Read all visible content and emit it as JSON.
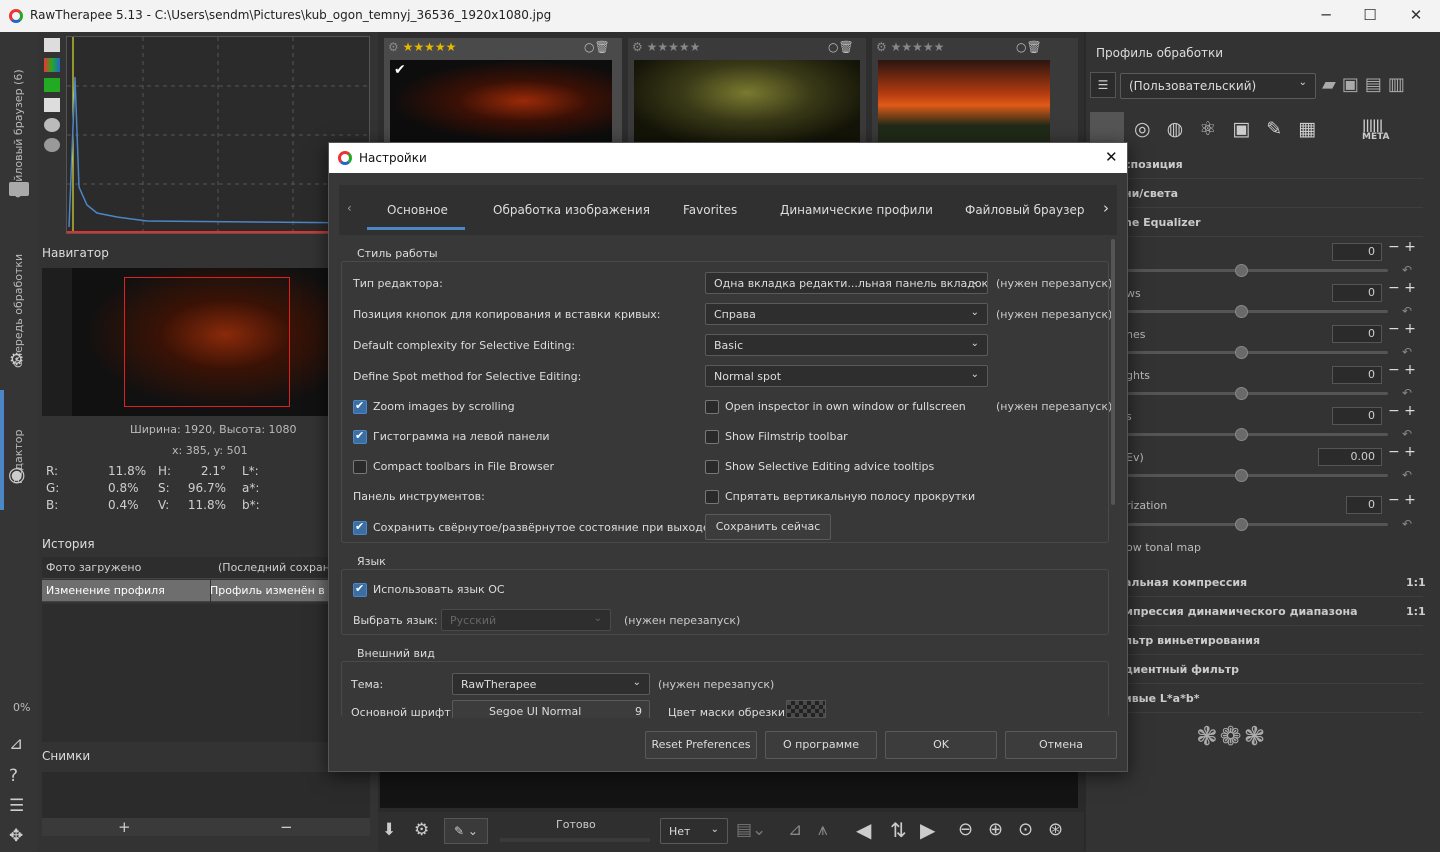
{
  "window": {
    "title": "RawTherapee 5.13 - C:\\Users\\sendm\\Pictures\\kub_ogon_temnyj_36536_1920x1080.jpg",
    "minimize": "─",
    "maximize": "☐",
    "close": "✕"
  },
  "sidebar": {
    "tabs": [
      "Файловый браузер (6)",
      "Очередь обработки",
      "Редактор"
    ],
    "zoom_label": "0%"
  },
  "navigator": {
    "title": "Навигатор",
    "dims": "Ширина: 1920, Высота: 1080",
    "coords": "x: 385, y: 501",
    "readout": [
      [
        "R:",
        "11.8%",
        "H:",
        "2.1°",
        "L*:"
      ],
      [
        "G:",
        "0.8%",
        "S:",
        "96.7%",
        "a*:"
      ],
      [
        "B:",
        "0.4%",
        "V:",
        "11.8%",
        "b*:"
      ]
    ]
  },
  "history": {
    "title": "История",
    "rows": [
      [
        "Фото загружено",
        "(Последний сохранё"
      ],
      [
        "Изменение профиля",
        "Профиль изменён в б"
      ]
    ]
  },
  "snapshots": {
    "title": "Снимки",
    "add": "+",
    "remove": "−"
  },
  "filmstrip": {
    "thumbs": [
      {
        "stars": "★★★★★",
        "filled": true
      },
      {
        "stars": "★★★★★",
        "filled": false
      },
      {
        "stars": "★★★★★",
        "filled": false
      }
    ]
  },
  "right": {
    "profile_title": "Профиль обработки",
    "profile_value": "(Пользовательский)",
    "meta": "META",
    "sections": [
      "спозиция",
      "ни/света",
      "ne Equalizer"
    ],
    "sliders": [
      {
        "label": "",
        "value": "0"
      },
      {
        "label": "ws",
        "value": "0"
      },
      {
        "label": "nes",
        "value": "0"
      },
      {
        "label": "ghts",
        "value": "0"
      },
      {
        "label": "s",
        "value": "0"
      },
      {
        "label": "Ev)",
        "value": "0.00"
      },
      {
        "label": "rization",
        "value": "0"
      }
    ],
    "tonalmap": "ow tonal map",
    "rows": [
      {
        "label": "альная компрессия",
        "val": "1:1"
      },
      {
        "label": "мпрессия динамического диапазона",
        "val": "1:1"
      },
      {
        "label": "льтр виньетирования",
        "val": ""
      },
      {
        "label": "диентный фильтр",
        "val": ""
      },
      {
        "label": "ивые L*a*b*",
        "val": ""
      }
    ]
  },
  "bottom": {
    "status": "Готово",
    "select": "Нет"
  },
  "dialog": {
    "title": "Настройки",
    "close": "✕",
    "tabs": [
      "Основное",
      "Обработка изображения",
      "Favorites",
      "Динамические профили",
      "Файловый браузер"
    ],
    "workflow": {
      "title": "Стиль работы",
      "editor_label": "Тип редактора:",
      "editor_value": "Одна вкладка редакти...льная панель вкладок",
      "curves_label": "Позиция кнопок для копирования и вставки кривых:",
      "curves_value": "Справа",
      "complexity_label": "Default complexity for Selective Editing:",
      "complexity_value": "Basic",
      "spot_label": "Define Spot method for Selective Editing:",
      "spot_value": "Normal spot",
      "restart": "(нужен перезапуск)",
      "zoom_scroll": "Zoom images by scrolling",
      "inspector": "Open inspector in own window or fullscreen",
      "hist_left": "Гистограмма на левой панели",
      "filmstrip_toolbar": "Show Filmstrip toolbar",
      "compact": "Compact toolbars in File Browser",
      "advice": "Show Selective Editing advice tooltips",
      "toolpanel": "Панель инструментов:",
      "hide_scroll": "Спрятать вертикальную полосу прокрутки",
      "save_state": "Сохранить свёрнутое/развёрнутое состояние при выходе",
      "save_now": "Сохранить сейчас"
    },
    "language": {
      "title": "Язык",
      "use_os": "Использовать язык ОС",
      "choose_label": "Выбрать язык:",
      "choose_value": "Русский",
      "restart": "(нужен перезапуск)"
    },
    "appearance": {
      "title": "Внешний вид",
      "theme_label": "Тема:",
      "theme_value": "RawTherapee",
      "restart": "(нужен перезапуск)",
      "font_label": "Основной шрифт",
      "font_value": "Segoe UI Normal",
      "font_size": "9",
      "mask_label": "Цвет маски обрезки:"
    },
    "buttons": {
      "reset": "Reset Preferences",
      "about": "О программе",
      "ok": "OK",
      "cancel": "Отмена"
    }
  }
}
